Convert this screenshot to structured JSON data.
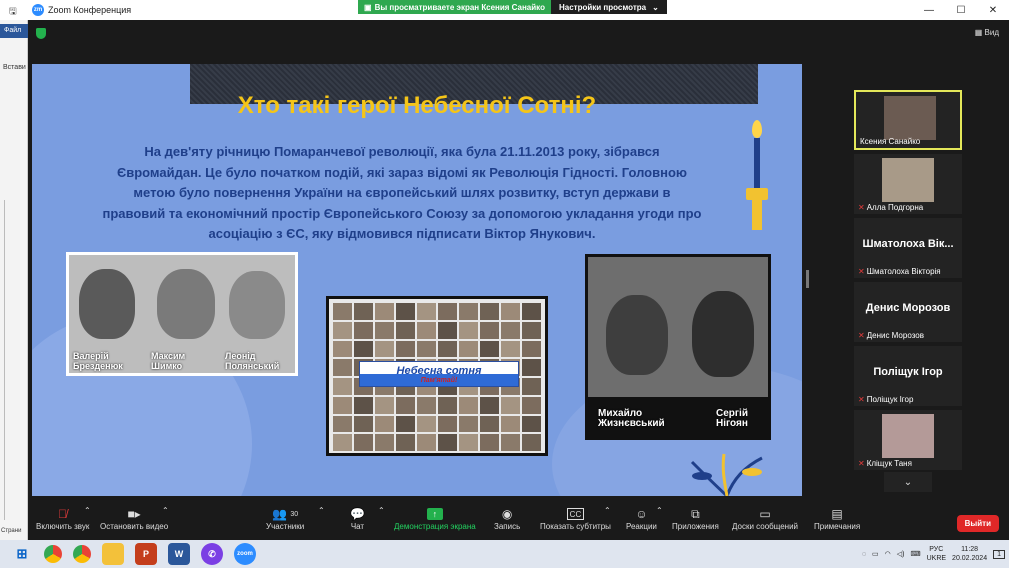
{
  "window": {
    "title": "Zoom Конференция",
    "minimize": "—",
    "maximize": "☐",
    "close": "✕"
  },
  "share_banner": {
    "text": "Вы просматриваете экран Ксения Санайко",
    "view_options": "Настройки просмотра"
  },
  "word": {
    "file_tab": "Файл",
    "paste": "Встави",
    "pages": "Страни"
  },
  "top_right": {
    "view_label": "Вид"
  },
  "slide": {
    "heading": "Хто такі герої Небесної Сотні?",
    "paragraph": "На дев'яту річницю Помаранчевої революції, яка була 21.11.2013 року, зібрався Євромайдан. Це було початком подій, які зараз відомі як Революція Гідності. Головною метою було повернення України на європейський шлях розвитку, вступ держави в правовий та економічний простір Європейського Союзу за допомогою укладання угоди про асоціацію з ЄС, яку відмовився підписати Віктор Янукович.",
    "photo1_names": [
      {
        "first": "Валерій",
        "last": "Брезденюк"
      },
      {
        "first": "Максим",
        "last": "Шимко"
      },
      {
        "first": "Леонід",
        "last": "Полянський"
      }
    ],
    "banner_title": "Небесна сотня",
    "banner_subtitle": "Пам'ятай!",
    "photo3_names": [
      {
        "first": "Михайло",
        "last": "Жизнєвський"
      },
      {
        "first": "Сергій",
        "last": "Нігоян"
      }
    ]
  },
  "participants": [
    {
      "name": "Ксения Санайко",
      "type": "photo",
      "active": true,
      "muted": false
    },
    {
      "name": "Алла Подгорна",
      "type": "photo",
      "active": false,
      "muted": true
    },
    {
      "big": "Шматолоха Вік...",
      "name": "Шматолоха Вікторія",
      "type": "name",
      "muted": true
    },
    {
      "big": "Денис Морозов",
      "name": "Денис Морозов",
      "type": "name",
      "muted": true
    },
    {
      "big": "Поліщук Ігор",
      "name": "Поліщук Ігор",
      "type": "name",
      "muted": true
    },
    {
      "name": "Кліщук Таня",
      "type": "photo",
      "active": false,
      "muted": true
    }
  ],
  "toolbar": {
    "unmute": "Включить звук",
    "stop_video": "Остановить видео",
    "participants": "Участники",
    "participants_count": "30",
    "chat": "Чат",
    "share": "Демонстрация экрана",
    "record": "Запись",
    "captions": "Показать субтитры",
    "reactions": "Реакции",
    "apps": "Приложения",
    "whiteboards": "Доски сообщений",
    "notes": "Примечания",
    "leave": "Выйти"
  },
  "taskbar": {
    "lang_top": "РУС",
    "lang_bottom": "UKRE",
    "time": "11:28",
    "date": "20.02.2024",
    "notifications": "1"
  },
  "colors": {
    "accent_green": "#23b14d",
    "leave_red": "#e02828",
    "slide_bg": "#7a9de0",
    "heading_yellow": "#f5c518"
  }
}
